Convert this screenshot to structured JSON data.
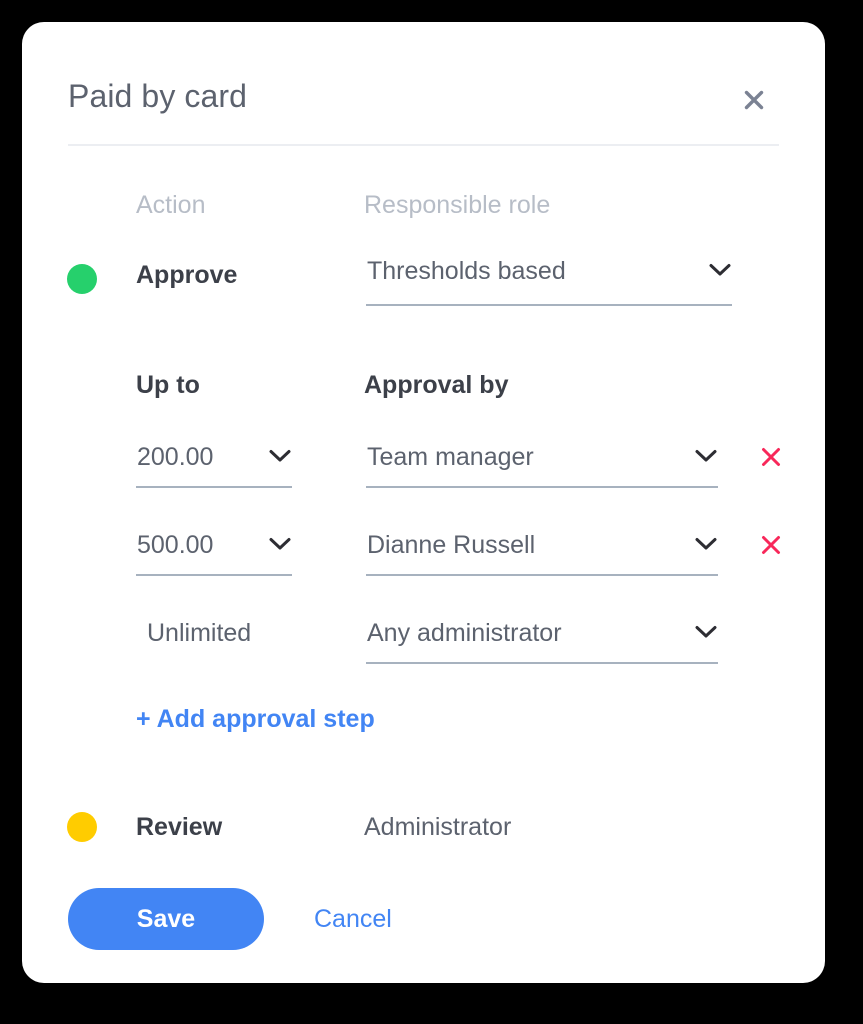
{
  "colors": {
    "accent_blue": "#4285f4",
    "status_green": "#26d06c",
    "status_yellow": "#ffcc00",
    "danger_red": "#f8285a",
    "text_dark": "#3c4049",
    "text_muted": "#5c626e",
    "text_placeholder": "#b7bdc7",
    "underline": "#a7b2bf",
    "divider": "#eceef2",
    "page_background": "#000000",
    "card_background": "#ffffff"
  },
  "dialog": {
    "title": "Paid by card",
    "close_icon": "close-icon"
  },
  "columns": {
    "action": "Action",
    "responsible_role": "Responsible role"
  },
  "approve": {
    "status_color": "#26d06c",
    "label": "Approve",
    "role_value": "Thresholds based",
    "chevron_icon": "chevron-down-icon"
  },
  "thresholds": {
    "up_to_header": "Up to",
    "approval_by_header": "Approval by",
    "rows": [
      {
        "amount": "200.00",
        "amount_editable": true,
        "approver": "Team manager",
        "removable": true
      },
      {
        "amount": "500.00",
        "amount_editable": true,
        "approver": "Dianne Russell",
        "removable": true
      },
      {
        "amount": "Unlimited",
        "amount_editable": false,
        "approver": "Any administrator",
        "removable": false
      }
    ],
    "add_step_label": "+ Add approval step"
  },
  "review": {
    "status_color": "#ffcc00",
    "label": "Review",
    "role_value": "Administrator"
  },
  "footer": {
    "save_label": "Save",
    "cancel_label": "Cancel"
  }
}
